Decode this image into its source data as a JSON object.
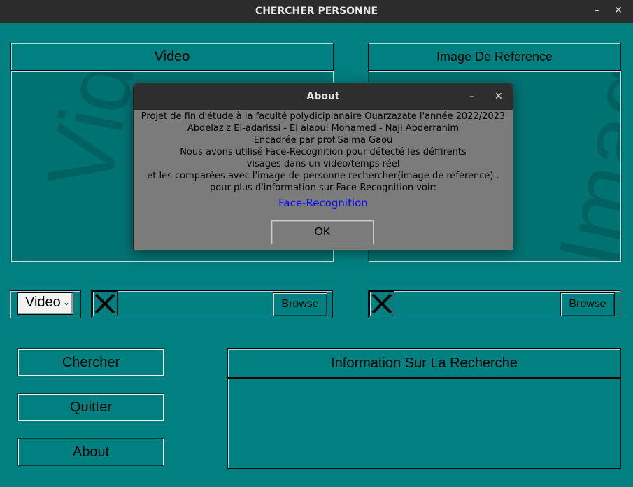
{
  "window": {
    "title": "CHERCHER PERSONNE",
    "minimize": "–",
    "close": "✕"
  },
  "video_panel": {
    "header": "Video",
    "watermark": "Video"
  },
  "image_panel": {
    "header": "Image De Reference",
    "watermark": "Image"
  },
  "source_select": {
    "value": "Video",
    "arrow": "⌄"
  },
  "video_file": {
    "browse_label": "Browse"
  },
  "image_file": {
    "browse_label": "Browse"
  },
  "actions": {
    "search": "Chercher",
    "quit": "Quitter",
    "about": "About"
  },
  "info_panel": {
    "header": "Information Sur La Recherche",
    "content": ""
  },
  "about_dialog": {
    "title": "About",
    "minimize": "–",
    "close": "✕",
    "lines": [
      "Projet de fin d'étude à la faculté polydiciplanaire Ouarzazate l'année 2022/2023",
      "Abdelaziz El-adarissi - El alaoui Mohamed - Naji Abderrahim",
      "Encadrée par prof.Salma Gaou",
      "Nous avons utilisé Face-Recognition pour détecté les déffirents",
      "visages dans un video/temps réel",
      "et les comparées avec l'image de personne rechercher(image de référence) .",
      "pour plus d'information sur Face-Recognition voir:"
    ],
    "link": "Face-Recognition",
    "ok": "OK"
  },
  "colors": {
    "background": "#008080",
    "titlebar": "#2c2c2c",
    "dialog": "#7b7b7b",
    "link": "#0a0aff"
  }
}
